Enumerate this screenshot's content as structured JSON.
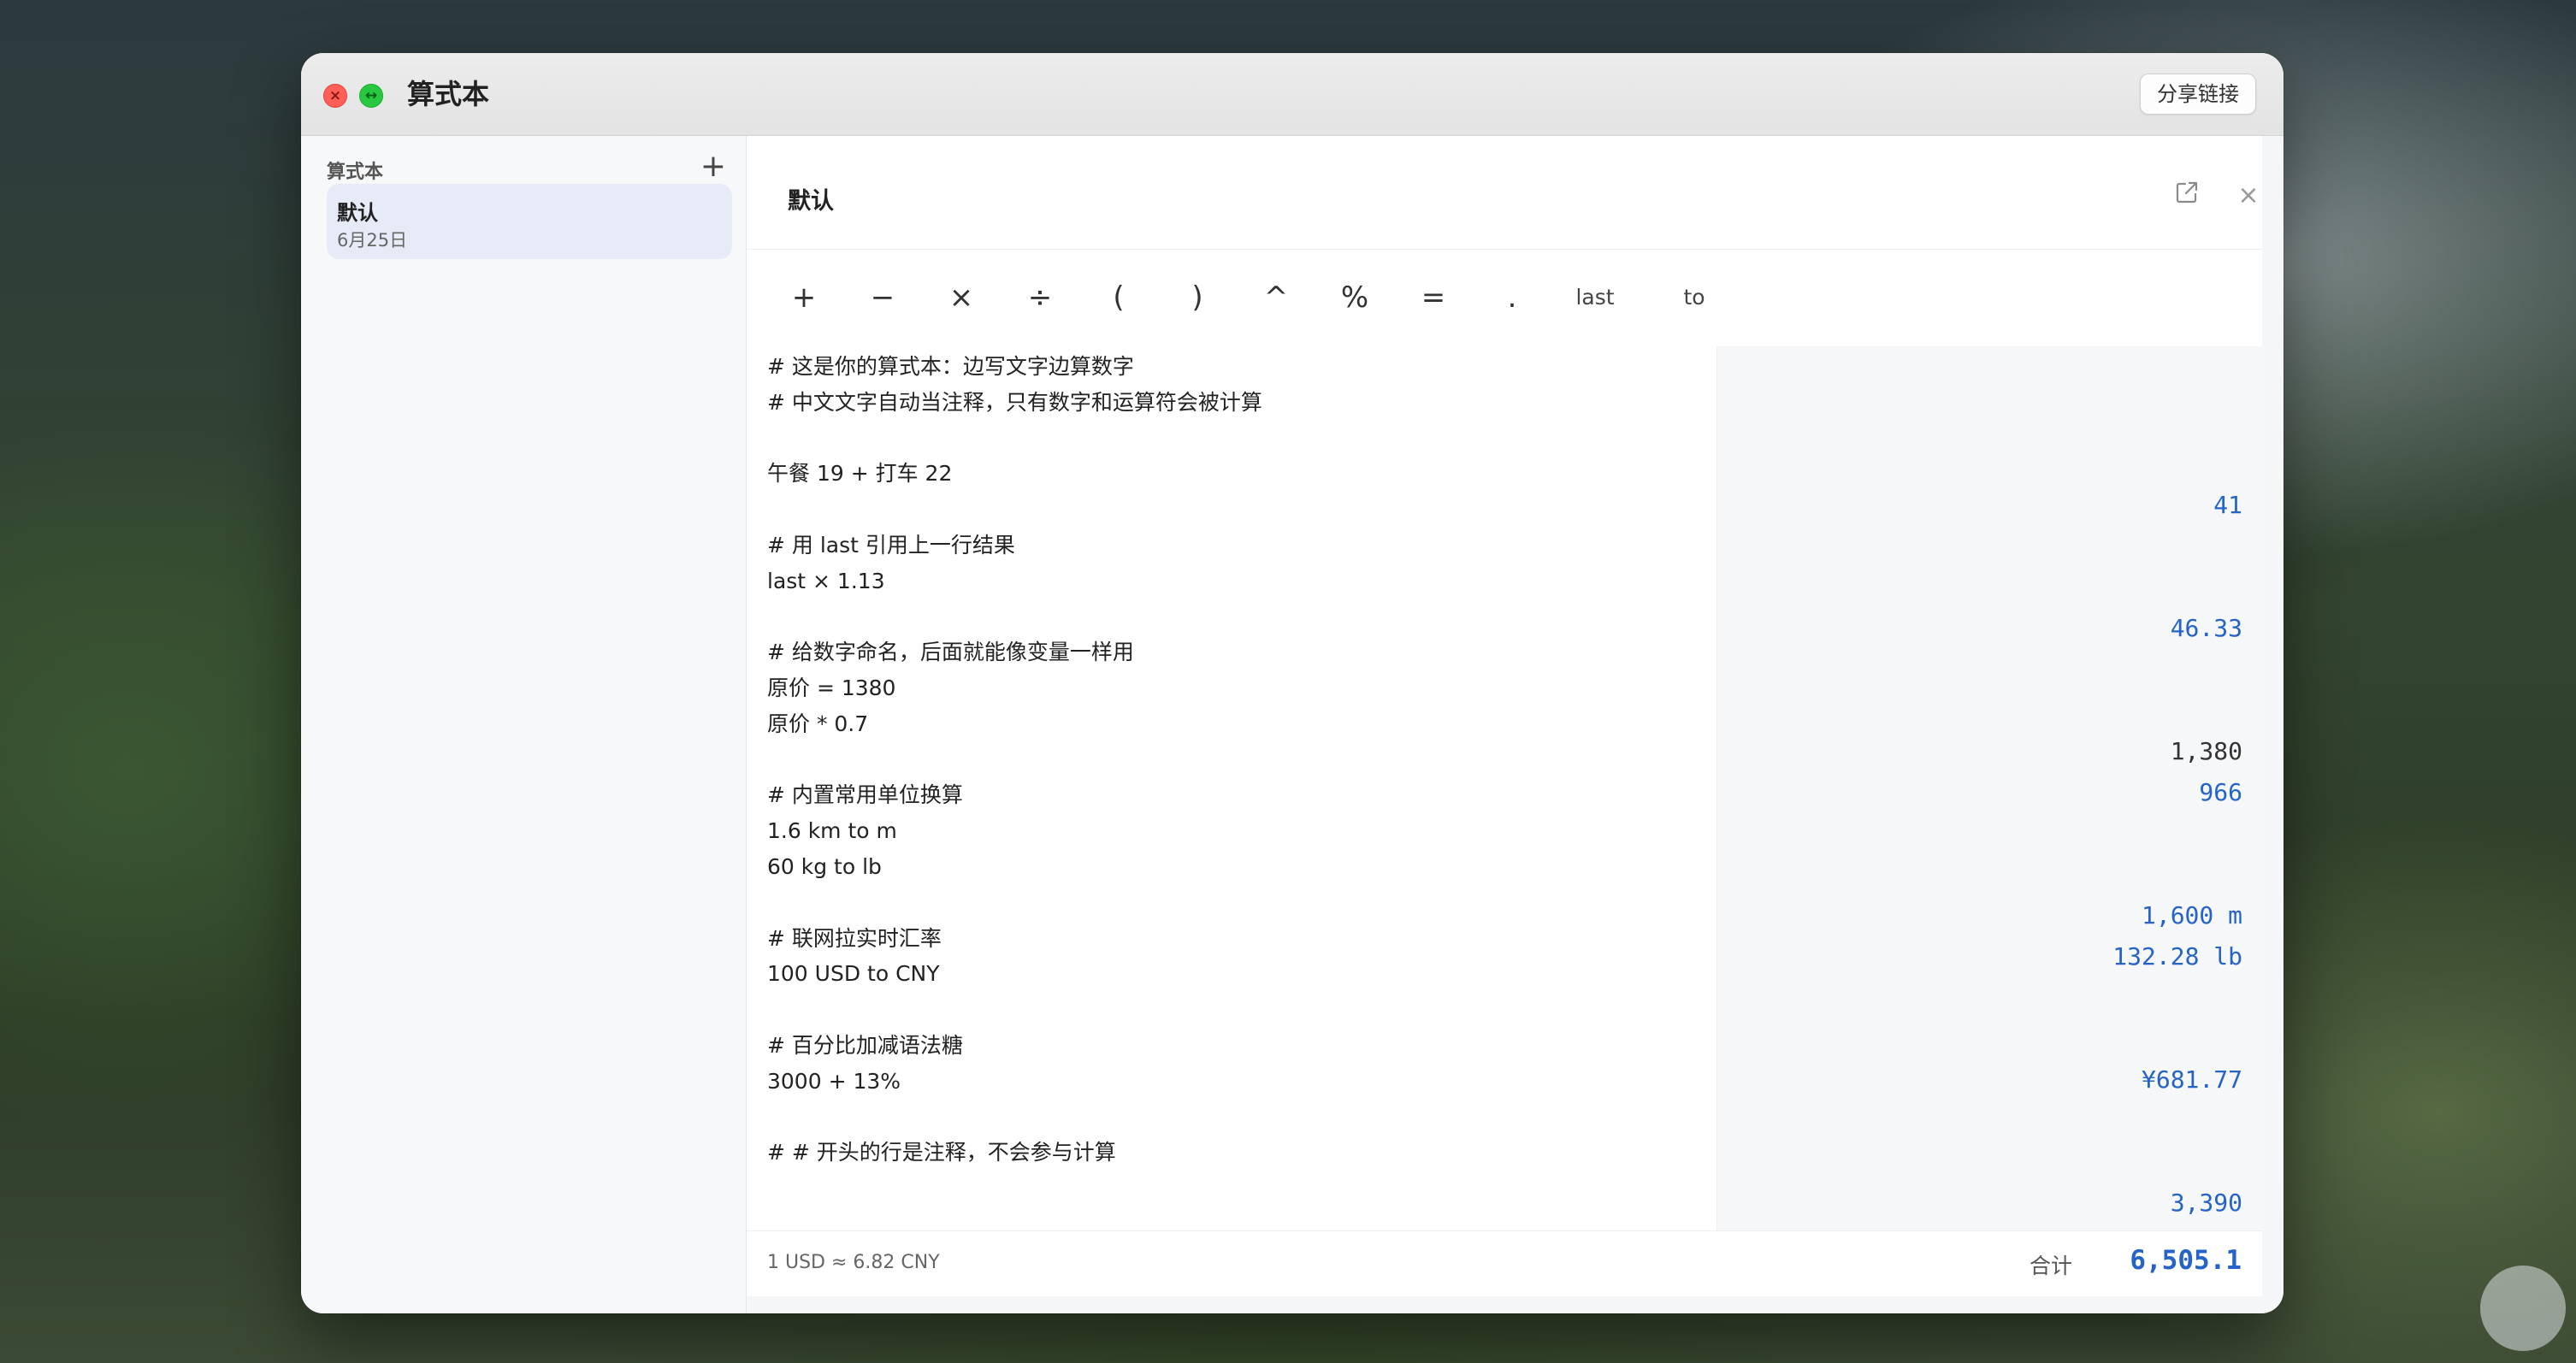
{
  "window": {
    "title": "算式本",
    "share_label": "分享链接"
  },
  "colors": {
    "accent": "#2563c9",
    "neutral_result": "#333333",
    "close": "#ff5f57",
    "zoom": "#28c840"
  },
  "sidebar": {
    "title": "算式本",
    "add_label": "+",
    "items": [
      {
        "name": "默认",
        "date": "6月25日"
      }
    ]
  },
  "note": {
    "title": "默认",
    "icons": [
      "external-link-icon",
      "close-icon"
    ],
    "close_label": "×"
  },
  "toolbar": {
    "keys": [
      "+",
      "−",
      "×",
      "÷",
      "(",
      ")",
      "^",
      "%",
      "=",
      ".",
      "last",
      "to"
    ]
  },
  "editor": {
    "lines": [
      "# 这是你的算式本：边写文字边算数字",
      "# 中文文字自动当注释，只有数字和运算符会被计算",
      "",
      "午餐 19 + 打车 22",
      "",
      "# 用 last 引用上一行结果",
      "last × 1.13",
      "",
      "# 给数字命名，后面就能像变量一样用",
      "原价 = 1380",
      "原价 * 0.7",
      "",
      "# 内置常用单位换算",
      "1.6 km to m",
      "60 kg to lb",
      "",
      "# 联网拉实时汇率",
      "100 USD to CNY",
      "",
      "# 百分比加减语法糖",
      "3000 + 13%",
      "",
      "# # 开头的行是注释，不会参与计算"
    ]
  },
  "results": [
    {
      "text": "41",
      "tone": "accent"
    },
    {
      "text": "46.33",
      "tone": "accent"
    },
    {
      "text": "1,380",
      "tone": "neutral"
    },
    {
      "text": "966",
      "tone": "accent"
    },
    {
      "text": "1,600 m",
      "tone": "accent"
    },
    {
      "text": "132.28 lb",
      "tone": "accent"
    },
    {
      "text": "¥681.77",
      "tone": "accent"
    },
    {
      "text": "3,390",
      "tone": "accent"
    }
  ],
  "footer": {
    "exchange_rate": "1 USD ≈ 6.82 CNY",
    "total_label": "合计",
    "total_value": "6,505.1"
  }
}
